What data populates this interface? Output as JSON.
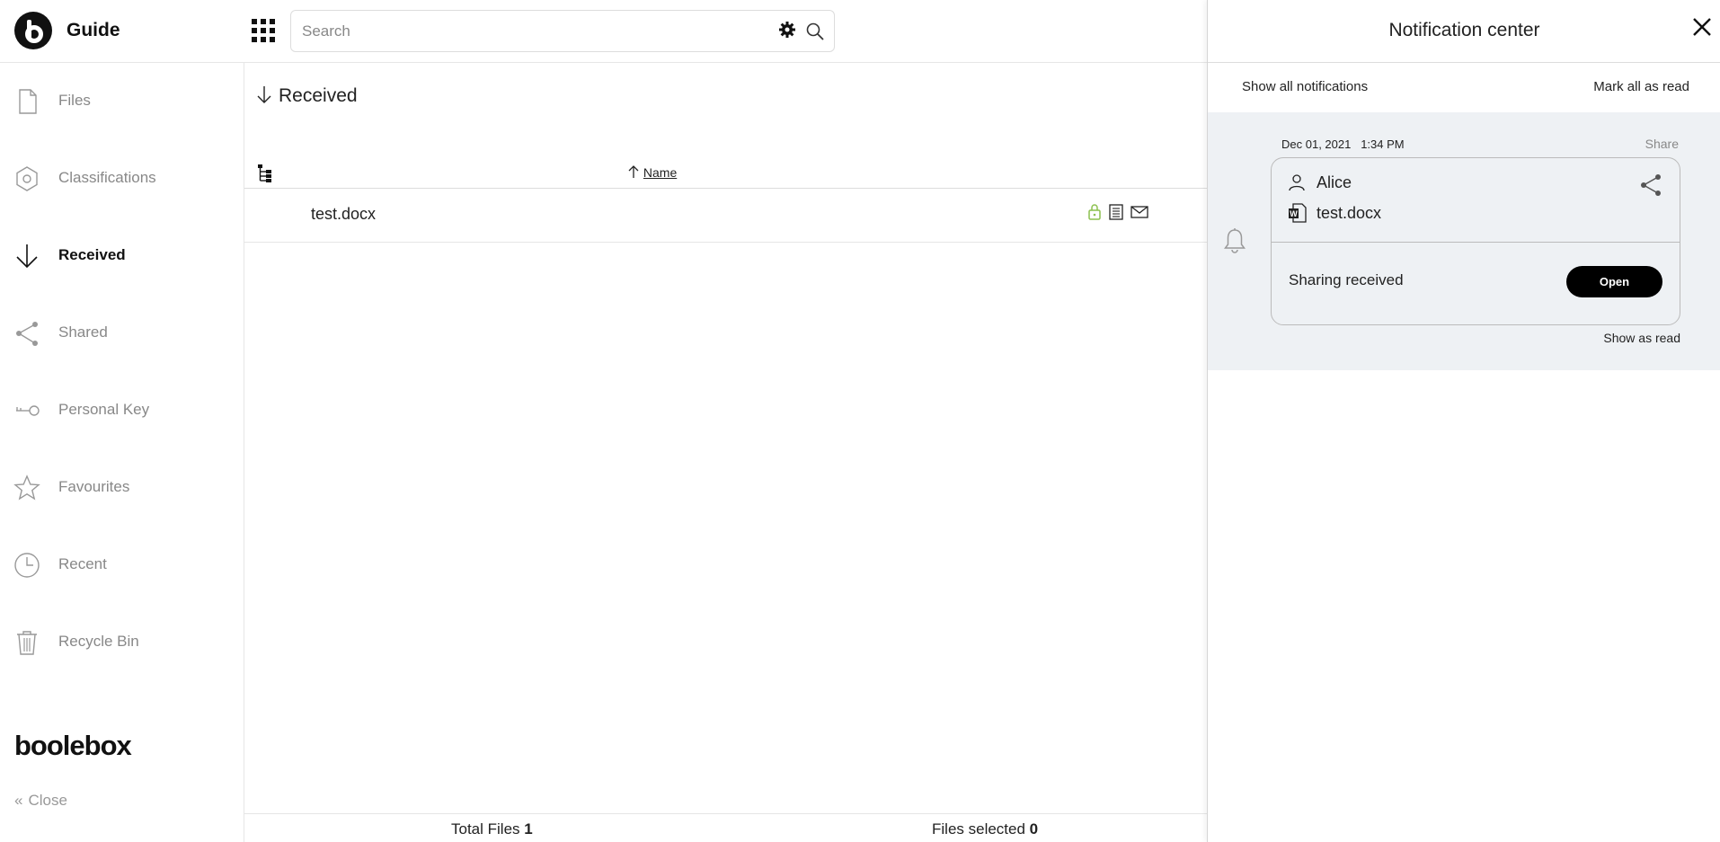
{
  "header": {
    "app_title": "Guide",
    "search": {
      "placeholder": "Search",
      "value": ""
    }
  },
  "sidebar": {
    "items": [
      {
        "label": "Files",
        "icon": "file-icon",
        "active": false
      },
      {
        "label": "Classifications",
        "icon": "hexagon-icon",
        "active": false
      },
      {
        "label": "Received",
        "icon": "arrow-down-icon",
        "active": true
      },
      {
        "label": "Shared",
        "icon": "share-icon",
        "active": false
      },
      {
        "label": "Personal Key",
        "icon": "key-icon",
        "active": false
      },
      {
        "label": "Favourites",
        "icon": "star-icon",
        "active": false
      },
      {
        "label": "Recent",
        "icon": "clock-icon",
        "active": false
      },
      {
        "label": "Recycle Bin",
        "icon": "trash-icon",
        "active": false
      }
    ],
    "brand": "boolebox",
    "close_label": "Close"
  },
  "main": {
    "breadcrumb": "Received",
    "columns": {
      "name": "Name"
    },
    "files": [
      {
        "name": "test.docx",
        "icons": [
          "lock-icon",
          "document-details-icon",
          "mail-icon"
        ]
      }
    ],
    "footer": {
      "total_label": "Total Files",
      "total_value": "1",
      "selected_label": "Files selected",
      "selected_value": "0"
    }
  },
  "notifications": {
    "title": "Notification center",
    "show_all": "Show all notifications",
    "mark_all": "Mark all as read",
    "items": [
      {
        "date": "Dec 01, 2021",
        "time": "1:34 PM",
        "type": "Share",
        "user": "Alice",
        "file": "test.docx",
        "message": "Sharing received",
        "action": "Open",
        "show_as_read": "Show as read"
      }
    ]
  },
  "colors": {
    "accent": "#000000",
    "lock_green": "#8cc04f",
    "notification_bg": "#eef1f4",
    "muted_text": "#888888"
  }
}
